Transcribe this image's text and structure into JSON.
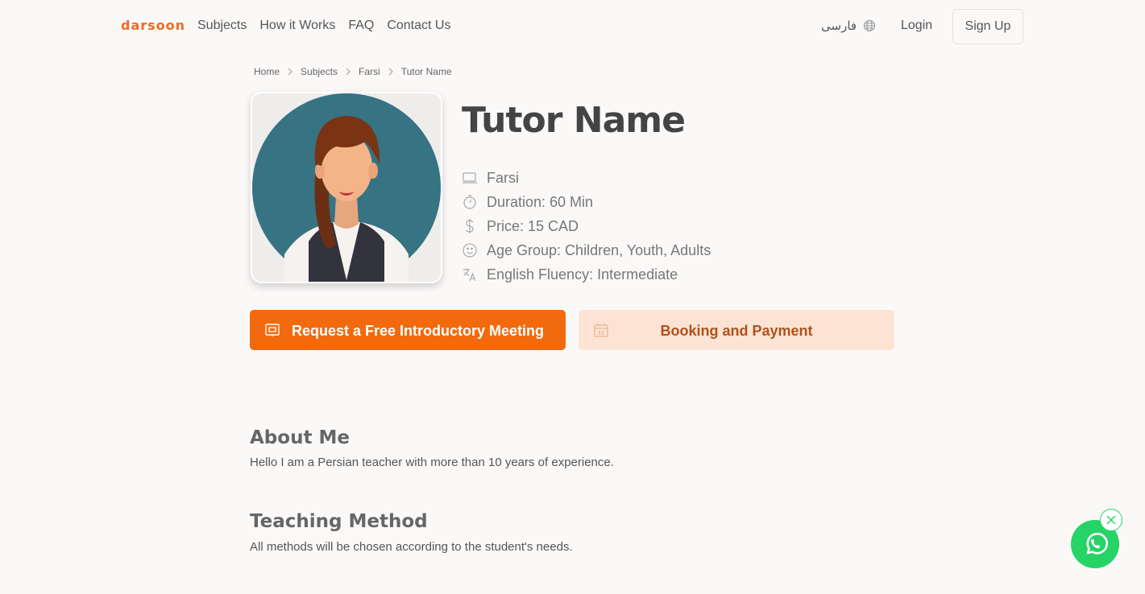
{
  "nav": {
    "logo": "darsoon",
    "links": [
      "Subjects",
      "How it Works",
      "FAQ",
      "Contact Us"
    ],
    "language": "فارسی",
    "login": "Login",
    "signup": "Sign Up"
  },
  "breadcrumb": [
    "Home",
    "Subjects",
    "Farsi",
    "Tutor Name"
  ],
  "profile": {
    "name": "Tutor Name",
    "details": [
      {
        "icon": "laptop-icon",
        "text": "Farsi"
      },
      {
        "icon": "stopwatch-icon",
        "text": "Duration: 60 Min"
      },
      {
        "icon": "dollar-icon",
        "text": "Price: 15 CAD"
      },
      {
        "icon": "smiley-icon",
        "text": "Age Group: Children, Youth, Adults"
      },
      {
        "icon": "translate-icon",
        "text": "English Fluency: Intermediate"
      }
    ]
  },
  "actions": {
    "request_meeting": "Request a Free Introductory Meeting",
    "booking": "Booking and Payment"
  },
  "about": {
    "title": "About Me",
    "text": "Hello I am a Persian teacher with more than 10 years of experience."
  },
  "method": {
    "title": "Teaching Method",
    "text": "All methods will be chosen according to the student's needs."
  },
  "colors": {
    "brand": "#f26a21",
    "primary_button": "#f26a0d",
    "secondary_button": "#fde3d3",
    "whatsapp": "#25d366",
    "background": "#fbf9f8"
  }
}
